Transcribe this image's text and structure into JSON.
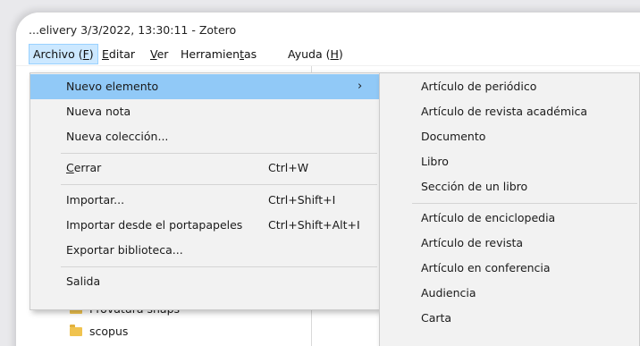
{
  "window": {
    "title": "...elivery 3/3/2022, 13:30:11 - Zotero"
  },
  "menubar": [
    {
      "pre": "Archivo (",
      "key": "F",
      "post": ")",
      "active": true
    },
    {
      "pre": "",
      "key": "E",
      "post": "ditar",
      "active": false
    },
    {
      "pre": "",
      "key": "V",
      "post": "er",
      "active": false
    },
    {
      "pre": "Herramien",
      "key": "t",
      "post": "as",
      "active": false
    },
    {
      "pre": "Ayuda (",
      "key": "H",
      "post": ")",
      "active": false
    }
  ],
  "tree": {
    "items": [
      {
        "label": "Provatura snaps"
      },
      {
        "label": "scopus"
      }
    ]
  },
  "file_menu": {
    "items": [
      {
        "label": "Nuevo elemento",
        "shortcut": "",
        "has_submenu": true,
        "highlighted": true
      },
      {
        "label": "Nueva nota",
        "shortcut": ""
      },
      {
        "label": "Nueva colección...",
        "shortcut": ""
      },
      {
        "label_pre": "",
        "label_key": "C",
        "label_post": "errar",
        "shortcut": "Ctrl+W"
      },
      {
        "label": "Importar...",
        "shortcut": "Ctrl+Shift+I"
      },
      {
        "label": "Importar desde el portapapeles",
        "shortcut": "Ctrl+Shift+Alt+I"
      },
      {
        "label": "Exportar biblioteca...",
        "shortcut": ""
      },
      {
        "label": "Salida",
        "shortcut": ""
      }
    ],
    "submenu_arrow": "›"
  },
  "new_item_submenu": {
    "items": [
      {
        "label": "Artículo de periódico"
      },
      {
        "label": "Artículo de revista académica"
      },
      {
        "label": "Documento"
      },
      {
        "label": "Libro"
      },
      {
        "label": "Sección de un libro"
      },
      {
        "label": "Artículo de enciclopedia"
      },
      {
        "label": "Artículo de revista"
      },
      {
        "label": "Artículo en conferencia"
      },
      {
        "label": "Audiencia"
      },
      {
        "label": "Carta"
      }
    ]
  },
  "colors": {
    "highlight": "#91c9f7",
    "menu_bg": "#f2f2f2",
    "menubar_active": "#cce8ff",
    "folder": "#f0c34f"
  }
}
